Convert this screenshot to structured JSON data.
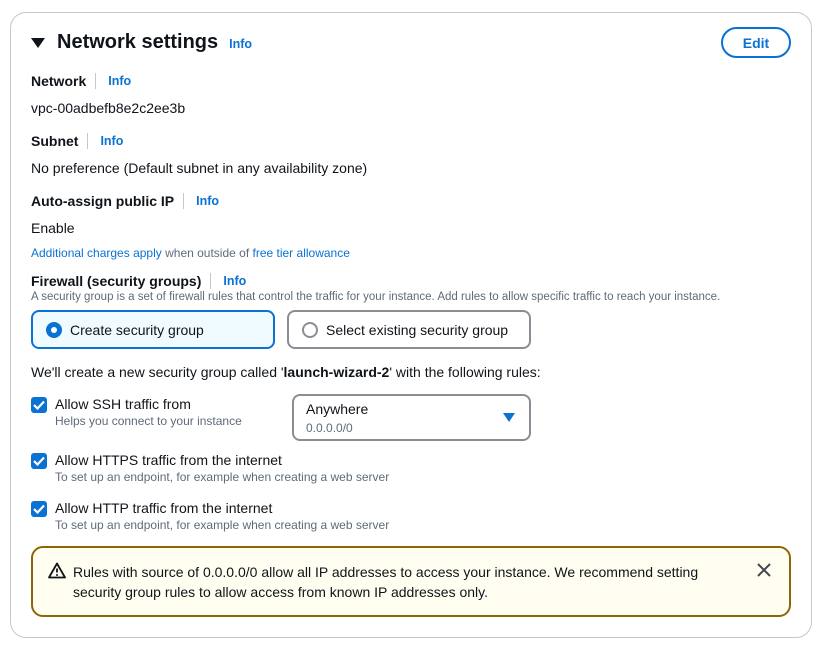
{
  "section": {
    "title": "Network settings",
    "info": "Info",
    "edit_label": "Edit"
  },
  "network": {
    "label": "Network",
    "info": "Info",
    "value": "vpc-00adbefb8e2c2ee3b"
  },
  "subnet": {
    "label": "Subnet",
    "info": "Info",
    "value": "No preference (Default subnet in any availability zone)"
  },
  "public_ip": {
    "label": "Auto-assign public IP",
    "info": "Info",
    "value": "Enable",
    "charges_link": "Additional charges apply",
    "charges_mid": " when outside of ",
    "free_tier_link": "free tier allowance"
  },
  "firewall": {
    "label": "Firewall (security groups)",
    "info": "Info",
    "description": "A security group is a set of firewall rules that control the traffic for your instance. Add rules to allow specific traffic to reach your instance.",
    "options": [
      {
        "label": "Create security group",
        "selected": true
      },
      {
        "label": "Select existing security group",
        "selected": false
      }
    ],
    "intro_pre": "We'll create a new security group called '",
    "group_name": "launch-wizard-2",
    "intro_post": "' with the following rules:"
  },
  "rules": [
    {
      "label": "Allow SSH traffic from",
      "sub": "Helps you connect to your instance",
      "checked": true
    },
    {
      "label": "Allow HTTPS traffic from the internet",
      "sub": "To set up an endpoint, for example when creating a web server",
      "checked": true
    },
    {
      "label": "Allow HTTP traffic from the internet",
      "sub": "To set up an endpoint, for example when creating a web server",
      "checked": true
    }
  ],
  "ssh_source": {
    "value": "Anywhere",
    "sub": "0.0.0.0/0"
  },
  "alert": {
    "icon": "warning-icon",
    "message": "Rules with source of 0.0.0.0/0 allow all IP addresses to access your instance. We recommend setting security group rules to allow access from known IP addresses only."
  },
  "colors": {
    "accent": "#0972d3",
    "warning_border": "#8d6605",
    "warning_bg": "#fffef0"
  }
}
